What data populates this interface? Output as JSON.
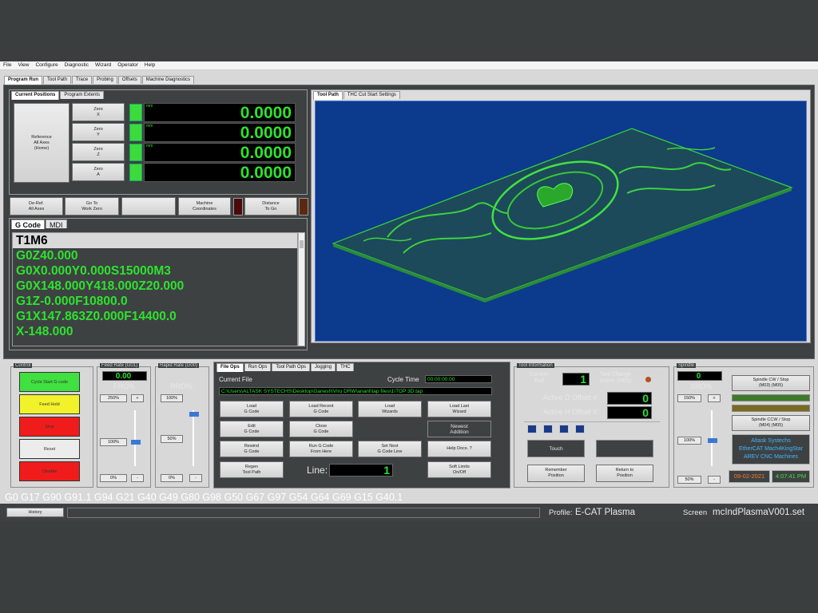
{
  "menu": [
    "File",
    "View",
    "Configure",
    "Diagnostic",
    "Wizard",
    "Operator",
    "Help"
  ],
  "main_tabs": [
    "Program Run",
    "Tool Path",
    "Trace",
    "Probing",
    "Offsets",
    "Machine Diagnostics"
  ],
  "positions": {
    "tabs": [
      "Current Positions",
      "Program Extents"
    ],
    "reference_btn": "Reference\nAll Axes\n(Home)",
    "axes": [
      {
        "zero": "Zero\nX",
        "unit": "mm",
        "value": "0.0000"
      },
      {
        "zero": "Zero\nY",
        "unit": "mm",
        "value": "0.0000"
      },
      {
        "zero": "Zero\nZ",
        "unit": "mm",
        "value": "0.0000"
      },
      {
        "zero": "Zero\nA",
        "unit": "",
        "value": "0.0000"
      }
    ],
    "btn_deref": "De-Ref.\nAll Axes",
    "btn_goto": "Go To\nWork Zero",
    "btn_machine": "Machine\nCoordinates",
    "btn_distance": "Distance\nTo Go"
  },
  "gcode": {
    "tabs": [
      "G Code",
      "MDI"
    ],
    "lines": [
      "T1M6",
      "G0Z40.000",
      "G0X0.000Y0.000S15000M3",
      "G0X148.000Y418.000Z20.000",
      "G1Z-0.000F10800.0",
      "G1X147.863Z0.000F14400.0",
      "X-148.000"
    ]
  },
  "toolpath": {
    "tabs": [
      "Tool Path",
      "THC Cut Start Settings"
    ]
  },
  "control": {
    "title": "Control",
    "cycle_start": "Cycle Start\nG code",
    "feed_hold": "Feed Hold",
    "stop": "Stop",
    "reset": "Reset",
    "disable": "Disable"
  },
  "feedrate": {
    "title": "Feed Rate (G01)",
    "value": "0.00",
    "label": "FRO%",
    "max": "250%",
    "mid": "100%",
    "min": "0%",
    "plus": "+",
    "minus": "-"
  },
  "rapid": {
    "title": "Rapid Rate (G00)",
    "label": "RRO%",
    "max": "100%",
    "mid": "50%",
    "min": "0%",
    "plus": "+",
    "minus": "-"
  },
  "fileops": {
    "tabs": [
      "File Ops",
      "Run Ops",
      "Tool Path Ops",
      "Jogging",
      "THC"
    ],
    "current_file_label": "Current File",
    "cycle_time_label": "Cycle Time",
    "cycle_time": "00:00:00.00",
    "path": "C:\\Users\\ALTASK SYSTECHS\\Desktop\\Ganesh\\Viru DRW\\anant\\tap files\\1\\TOP 3D.tap",
    "btns": {
      "load": "Load\nG Code",
      "load_recent": "Load Recent\nG Code",
      "load_wizards": "Load\nWizards",
      "load_last": "Load Last\nWizard",
      "edit": "Edit\nG Code",
      "close": "Close\nG Code",
      "newest": "Newest\nAddition",
      "rewind": "Rewind\nG Code",
      "run_from": "Run G Code\nFrom Here",
      "set_next": "Set Next\nG Code Line",
      "help": "Help Docs. ?",
      "regen": "Regen\nTool Path",
      "soft_limits": "Soft Limits\nOn/Off"
    },
    "line_label": "Line:",
    "line_value": "1"
  },
  "toolinfo": {
    "title": "Tool Information",
    "current_tool_label": "Current\nTool",
    "current_tool": "1",
    "tool_change_label": "Tool Change\nActive (M06)",
    "active_d_label": "Active D Offset #:",
    "active_d": "0",
    "active_h_label": "Active H Offset #:",
    "active_h": "0",
    "touch": "Touch",
    "remember": "Remember\nPosition",
    "return": "Return to\nPosition"
  },
  "spindle": {
    "title": "Spindle",
    "value": "0",
    "label": "SRO%",
    "max": "150%",
    "mid": "100%",
    "min": "50%",
    "plus": "+",
    "minus": "-",
    "cw": "Spindle CW / Stop\n(M03)          (M05)",
    "ccw": "Spindle CCW / Stop\n(M04)          (M05)",
    "brand": [
      "Altask Systechs",
      "EtherCAT Mach4KingStar",
      "AREV CNC Machines"
    ],
    "date": "09-02-2021",
    "time": "4:07:41 PM"
  },
  "modal": "G0 G17 G90 G91.1 G94 G21 G40 G49 G80 G98 G50 G67 G97 G54 G64 G69 G15 G40.1",
  "status": {
    "history": "History",
    "profile_label": "Profile:",
    "profile": "E-CAT Plasma",
    "screen_label": "Screen",
    "screen": "mcIndPlasmaV001.set"
  },
  "colors": {
    "dro_green": "#2de22d",
    "viewport_blue": "#0c3a8c",
    "panel_dark": "#3e4142"
  }
}
